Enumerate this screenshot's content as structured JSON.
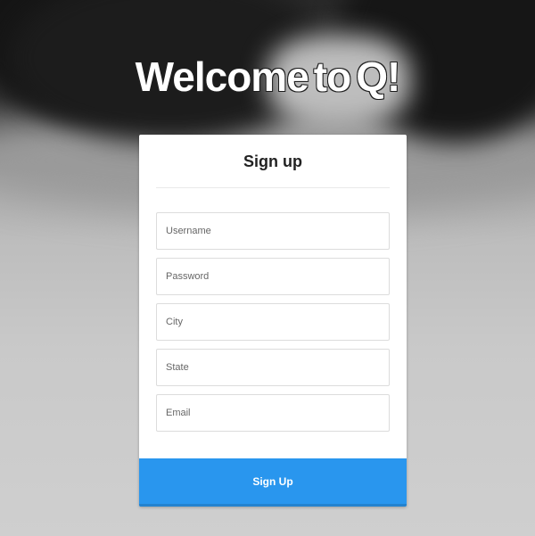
{
  "headline": {
    "parts": [
      "Welcome",
      "to",
      "Q!"
    ]
  },
  "form": {
    "title": "Sign up",
    "fields": [
      {
        "placeholder": "Username",
        "value": ""
      },
      {
        "placeholder": "Password",
        "value": ""
      },
      {
        "placeholder": "City",
        "value": ""
      },
      {
        "placeholder": "State",
        "value": ""
      },
      {
        "placeholder": "Email",
        "value": ""
      }
    ],
    "submit_label": "Sign Up"
  },
  "colors": {
    "accent": "#2996ee",
    "card_background": "#ffffff"
  }
}
